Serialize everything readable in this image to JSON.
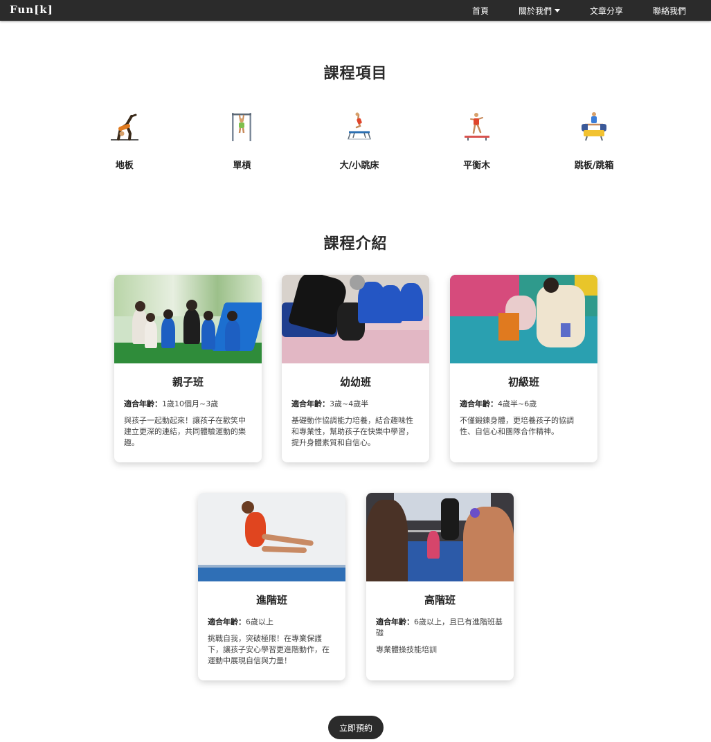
{
  "nav": {
    "brand": "Fun[k]",
    "links": [
      {
        "label": "首頁"
      },
      {
        "label": "關於我們"
      },
      {
        "label": "文章分享"
      },
      {
        "label": "聯絡我們"
      }
    ]
  },
  "courses_section": {
    "title": "課程項目",
    "items": [
      {
        "label": "地板",
        "icon": "floor-gymnast-icon"
      },
      {
        "label": "單槓",
        "icon": "bar-gymnast-icon"
      },
      {
        "label": "大/小跳床",
        "icon": "trampoline-icon"
      },
      {
        "label": "平衡木",
        "icon": "balance-beam-icon"
      },
      {
        "label": "跳板/跳箱",
        "icon": "vault-box-icon"
      }
    ]
  },
  "intro_section": {
    "title": "課程介紹",
    "age_prefix": "適合年齡：",
    "cards": [
      {
        "title": "親子班",
        "age": "1歲10個月~3歲",
        "desc": "與孩子一起動起來！讓孩子在歡笑中建立更深的連結，共同體驗運動的樂趣。"
      },
      {
        "title": "幼幼班",
        "age": "3歲~4歲半",
        "desc": "基礎動作協調能力培養，結合趣味性和專業性，幫助孩子在快樂中學習，提升身體素質和自信心。"
      },
      {
        "title": "初級班",
        "age": "4歲半~6歲",
        "desc": "不僅鍛鍊身體，更培養孩子的協調性、自信心和團隊合作精神。"
      },
      {
        "title": "進階班",
        "age": "6歲以上",
        "desc": "挑戰自我，突破極限！在專業保護下，讓孩子安心學習更進階動作，在運動中展現自信與力量！"
      },
      {
        "title": "高階班",
        "age": "6歲以上，且已有進階班基礎",
        "desc": "專業體操技能培訓"
      }
    ]
  },
  "cta": {
    "label": "立即預約"
  }
}
